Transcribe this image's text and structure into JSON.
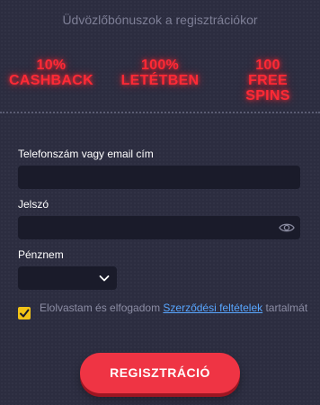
{
  "header": {
    "welcome_text": "Üdvözlőbónuszok a regisztrációkor"
  },
  "bonuses": [
    {
      "line1": "10%",
      "line2": "CASHBACK"
    },
    {
      "line1": "100%",
      "line2": "LETÉTBEN"
    },
    {
      "line1": "100",
      "line2": "FREE SPINS"
    }
  ],
  "form": {
    "phone_email_label": "Telefonszám vagy email cím",
    "phone_email_value": "",
    "password_label": "Jelszó",
    "password_value": "",
    "currency_label": "Pénznem",
    "currency_selected": ""
  },
  "terms": {
    "checked": true,
    "prefix": "Elolvastam és elfogadom ",
    "link_text": "Szerződési feltételek",
    "suffix": " tartalmát"
  },
  "register_button_label": "REGISZTRÁCIÓ",
  "colors": {
    "background": "#2c2d40",
    "neon_red": "#ff2a36",
    "input_bg": "#1a1b2a",
    "checkbox": "#f2c316",
    "link": "#58a6ff",
    "button": "#ef3444"
  },
  "icons": [
    "eye-icon",
    "chevron-down-icon",
    "checkmark-icon"
  ]
}
